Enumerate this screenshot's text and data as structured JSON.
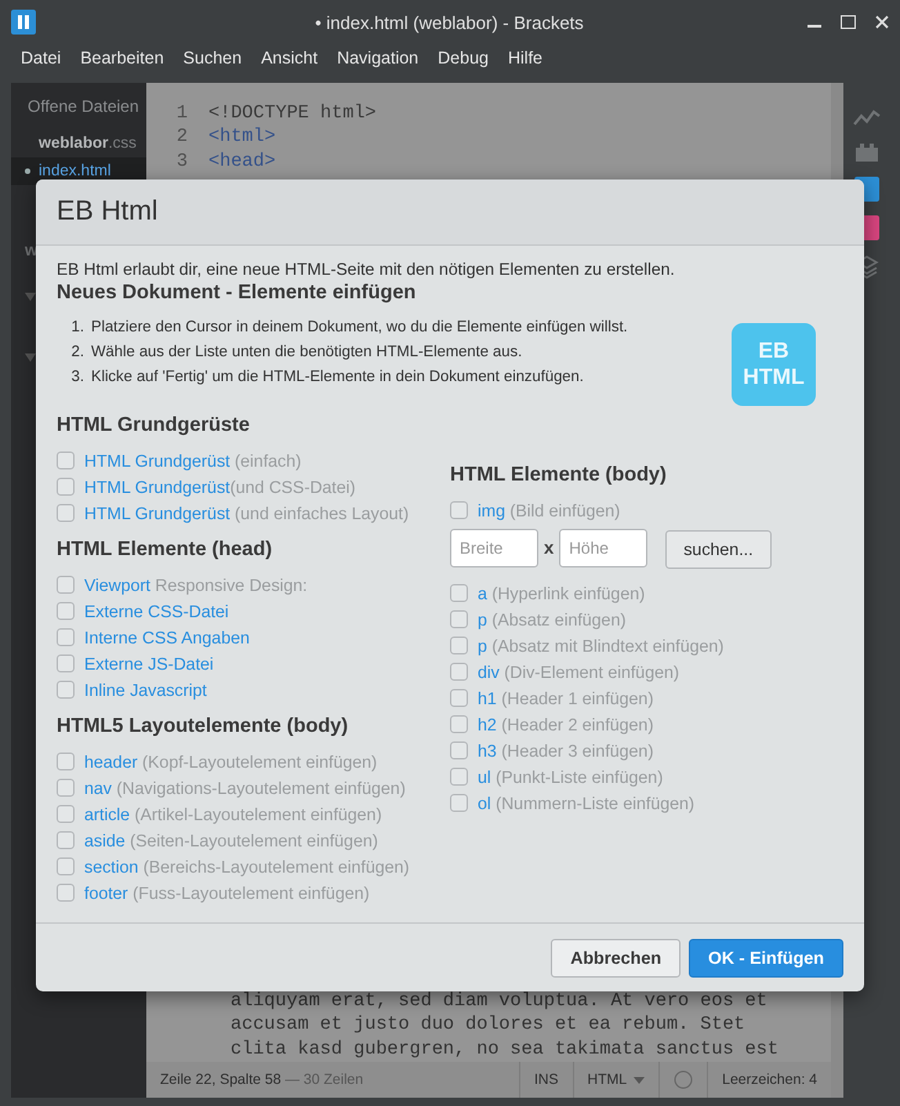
{
  "window": {
    "title": "• index.html (weblabor) - Brackets"
  },
  "menu": [
    "Datei",
    "Bearbeiten",
    "Suchen",
    "Ansicht",
    "Navigation",
    "Debug",
    "Hilfe"
  ],
  "sidebar": {
    "header": "Offene Dateien",
    "files": [
      {
        "name": "weblabor",
        "extension": ".css",
        "selected": false,
        "modified": false
      },
      {
        "name": "index.html",
        "selected": true,
        "modified": true
      }
    ],
    "project": "w"
  },
  "editor": {
    "code_top": [
      {
        "number": "1",
        "tokens": [
          {
            "text": "<!DOCTYPE html>",
            "kind": "plain"
          }
        ]
      },
      {
        "number": "2",
        "tokens": [
          {
            "text": "<html>",
            "kind": "tag"
          }
        ]
      },
      {
        "number": "3",
        "tokens": [
          {
            "text": "<head>",
            "kind": "tag"
          }
        ]
      }
    ],
    "code_bottom": [
      "aliquyam erat, sed diam voluptua. At vero eos et",
      "accusam et justo duo dolores et ea rebum. Stet",
      "clita kasd gubergren, no sea takimata sanctus est"
    ]
  },
  "status_bar": {
    "position": "Zeile 22, Spalte 58",
    "lines": "— 30 Zeilen",
    "mode": "INS",
    "language": "HTML",
    "indent": "Leerzeichen: 4"
  },
  "dialog": {
    "title": "EB Html",
    "intro": "EB Html erlaubt dir, eine neue HTML-Seite mit den nötigen Elementen zu erstellen.",
    "heading": "Neues Dokument - Elemente einfügen",
    "steps": [
      {
        "number": "1.",
        "text": "Platziere den Cursor in deinem Dokument, wo du die Elemente einfügen willst."
      },
      {
        "number": "2.",
        "text": "Wähle aus der Liste unten die benötigten HTML-Elemente aus."
      },
      {
        "number": "3.",
        "text": "Klicke auf 'Fertig' um die HTML-Elemente in dein Dokument einzufügen."
      }
    ],
    "logo": [
      "EB",
      "HTML"
    ],
    "left_groups": [
      {
        "title": "HTML Grundgerüste",
        "items": [
          {
            "label": "HTML Grundgerüst",
            "note": "(einfach)",
            "checked": false,
            "spaced": true
          },
          {
            "label": "HTML Grundgerüst",
            "note": "(und CSS-Datei)",
            "checked": false,
            "spaced": false
          },
          {
            "label": "HTML Grundgerüst",
            "note": "(und einfaches Layout)",
            "checked": false,
            "spaced": true
          }
        ]
      },
      {
        "title": "HTML Elemente (head)",
        "items": [
          {
            "label": "Viewport",
            "note": "Responsive Design:",
            "checked": false,
            "spaced": true
          },
          {
            "label": "Externe CSS-Datei",
            "checked": false
          },
          {
            "label": "Interne CSS Angaben",
            "checked": false
          },
          {
            "label": "Externe JS-Datei",
            "checked": false
          },
          {
            "label": "Inline Javascript",
            "checked": false
          }
        ]
      },
      {
        "title": "HTML5 Layoutelemente (body)",
        "items": [
          {
            "label": "header",
            "note": "(Kopf-Layoutelement einfügen)",
            "checked": false,
            "spaced": true
          },
          {
            "label": "nav",
            "note": "(Navigations-Layoutelement einfügen)",
            "checked": false,
            "spaced": true
          },
          {
            "label": "article",
            "note": "(Artikel-Layoutelement einfügen)",
            "checked": false,
            "spaced": true
          },
          {
            "label": "aside",
            "note": "(Seiten-Layoutelement einfügen)",
            "checked": false,
            "spaced": true
          },
          {
            "label": "section",
            "note": "(Bereichs-Layoutelement einfügen)",
            "checked": false,
            "spaced": true
          },
          {
            "label": "footer",
            "note": "(Fuss-Layoutelement einfügen)",
            "checked": false,
            "spaced": true
          }
        ]
      }
    ],
    "right_group": {
      "title": "HTML Elemente (body)",
      "items": [
        {
          "kind": "option",
          "label": "img",
          "note": "(Bild einfügen)",
          "checked": false
        },
        {
          "kind": "size",
          "width_placeholder": "Breite",
          "separator": "x",
          "height_placeholder": "Höhe",
          "button": "suchen..."
        },
        {
          "kind": "option",
          "label": "a",
          "note": "(Hyperlink einfügen)",
          "checked": false
        },
        {
          "kind": "option",
          "label": "p",
          "note": "(Absatz einfügen)",
          "checked": false
        },
        {
          "kind": "option",
          "label": "p",
          "note": "(Absatz mit Blindtext einfügen)",
          "checked": false
        },
        {
          "kind": "option",
          "label": "div",
          "note": "(Div-Element einfügen)",
          "checked": false
        },
        {
          "kind": "option",
          "label": "h1",
          "note": "(Header 1 einfügen)",
          "checked": false
        },
        {
          "kind": "option",
          "label": "h2",
          "note": "(Header 2 einfügen)",
          "checked": false
        },
        {
          "kind": "option",
          "label": "h3",
          "note": "(Header 3 einfügen)",
          "checked": false
        },
        {
          "kind": "option",
          "label": "ul",
          "note": "(Punkt-Liste einfügen)",
          "checked": false
        },
        {
          "kind": "option",
          "label": "ol",
          "note": "(Nummern-Liste einfügen)",
          "checked": false
        }
      ]
    },
    "buttons": [
      {
        "label": "Abbrechen",
        "primary": false
      },
      {
        "label": "OK - Einfügen",
        "primary": true
      }
    ]
  }
}
